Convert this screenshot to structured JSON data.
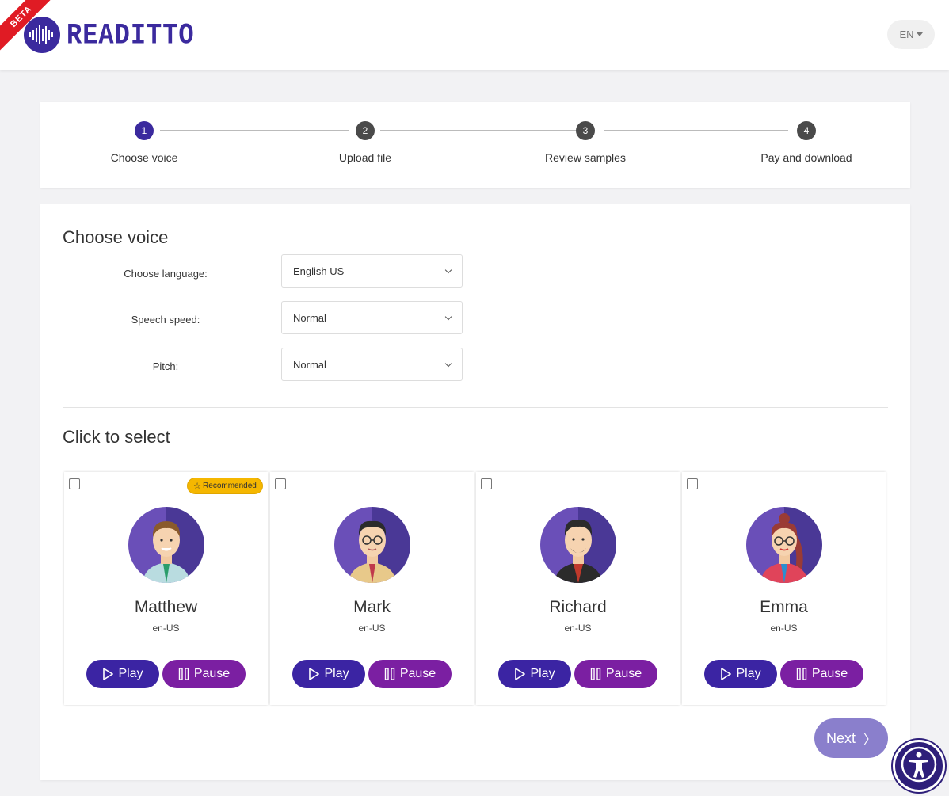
{
  "header": {
    "beta": "BETA",
    "logo_text": "READITTO",
    "lang": "EN"
  },
  "steps": [
    {
      "num": "1",
      "label": "Choose voice"
    },
    {
      "num": "2",
      "label": "Upload file"
    },
    {
      "num": "3",
      "label": "Review samples"
    },
    {
      "num": "4",
      "label": "Pay and download"
    }
  ],
  "form": {
    "title": "Choose voice",
    "language_label": "Choose language:",
    "language_value": "English US",
    "speed_label": "Speech speed:",
    "speed_value": "Normal",
    "pitch_label": "Pitch:",
    "pitch_value": "Normal"
  },
  "select_title": "Click to select",
  "badge": "Recommended",
  "voices": [
    {
      "name": "Matthew",
      "code": "en-US",
      "play": "Play",
      "pause": "Pause"
    },
    {
      "name": "Mark",
      "code": "en-US",
      "play": "Play",
      "pause": "Pause"
    },
    {
      "name": "Richard",
      "code": "en-US",
      "play": "Play",
      "pause": "Pause"
    },
    {
      "name": "Emma",
      "code": "en-US",
      "play": "Play",
      "pause": "Pause"
    }
  ],
  "next_label": "Next",
  "colors": {
    "brand": "#3b2a9e",
    "play": "#3b24a3",
    "pause": "#7b1fa2",
    "recommended": "#f5b700",
    "next": "#8a7fcc"
  }
}
